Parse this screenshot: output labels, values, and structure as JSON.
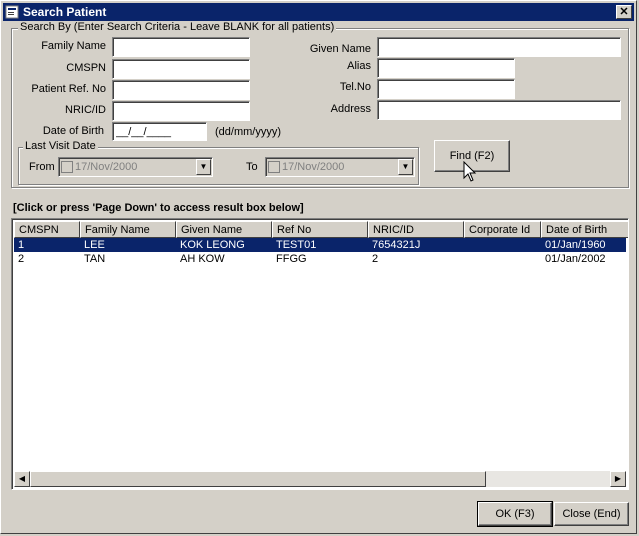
{
  "window": {
    "title": "Search Patient",
    "close_glyph": "✕"
  },
  "search_group": {
    "legend": "Search By (Enter Search Criteria - Leave BLANK for all patients)",
    "family_name": {
      "label": "Family Name",
      "value": ""
    },
    "cmspn": {
      "label": "CMSPN",
      "value": ""
    },
    "patient_ref_no": {
      "label": "Patient Ref. No",
      "value": ""
    },
    "nric_id": {
      "label": "NRIC/ID",
      "value": ""
    },
    "date_of_birth": {
      "label": "Date of Birth",
      "value": "__/__/____",
      "format_hint": "(dd/mm/yyyy)"
    },
    "given_name": {
      "label": "Given Name",
      "value": ""
    },
    "alias": {
      "label": "Alias",
      "value": ""
    },
    "tel_no": {
      "label": "Tel.No",
      "value": ""
    },
    "address": {
      "label": "Address",
      "value": ""
    }
  },
  "last_visit": {
    "legend": "Last Visit Date",
    "from_label": "From",
    "from_value": "17/Nov/2000",
    "to_label": "To",
    "to_value": "17/Nov/2000"
  },
  "find_button": {
    "label": "Find (F2)"
  },
  "results": {
    "hint": "[Click or press 'Page Down' to access result box below]",
    "columns": [
      "CMSPN",
      "Family Name",
      "Given Name",
      "Ref No",
      "NRIC/ID",
      "Corporate Id",
      "Date of Birth"
    ],
    "rows": [
      {
        "cmspn": "1",
        "family_name": "LEE",
        "given_name": "KOK LEONG",
        "ref_no": "TEST01",
        "nric_id": "7654321J",
        "corporate_id": "",
        "dob": "01/Jan/1960",
        "selected": true
      },
      {
        "cmspn": "2",
        "family_name": "TAN",
        "given_name": "AH KOW",
        "ref_no": "FFGG",
        "nric_id": "2",
        "corporate_id": "",
        "dob": "01/Jan/2002",
        "selected": false
      }
    ]
  },
  "footer": {
    "ok_label": "OK (F3)",
    "close_label": "Close (End)"
  },
  "colors": {
    "titlebar": "#0a246a",
    "face": "#d4d0c8",
    "selection": "#0a246a"
  }
}
